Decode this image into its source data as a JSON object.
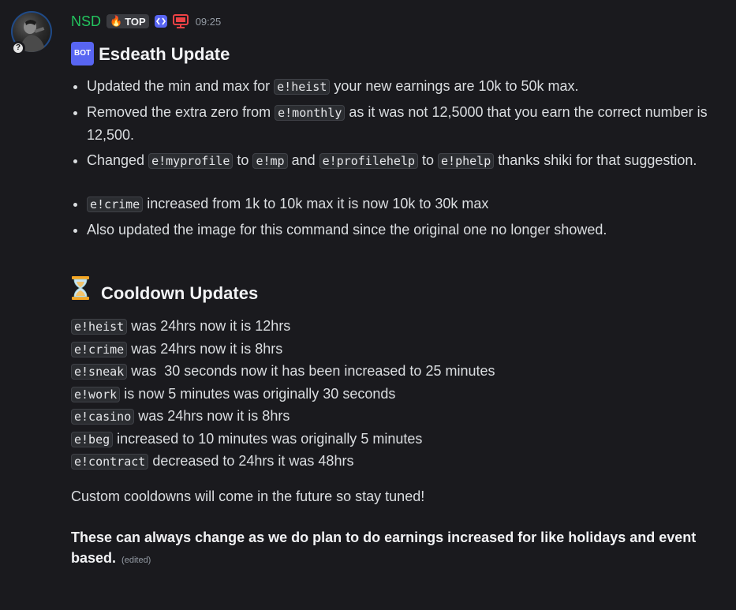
{
  "author": {
    "name": "NSD",
    "tag_label": "TOP",
    "timestamp": "09:25",
    "avatar_badge": "?",
    "name_color": "#23c45e"
  },
  "post": {
    "bot_label": "BOT",
    "title": "Esdeath Update",
    "bullets_1": [
      {
        "parts": [
          "Updated the min and max for ",
          "e!heist",
          " your new earnings are 10k to 50k max."
        ]
      },
      {
        "parts": [
          "Removed the extra zero from ",
          "e!monthly",
          " as it was not 12,5000 that you earn the correct number is 12,500."
        ]
      },
      {
        "parts": [
          "Changed ",
          "e!myprofile",
          " to ",
          "e!mp",
          " and ",
          "e!profilehelp",
          " to ",
          "e!phelp",
          " thanks shiki for that suggestion."
        ]
      }
    ],
    "bullets_2": [
      {
        "parts": [
          "e!crime",
          " increased from 1k to 10k max it is now 10k to 30k max"
        ]
      },
      {
        "parts": [
          "Also updated the image for this command since the original one no longer showed."
        ]
      }
    ],
    "cooldown_title": "Cooldown Updates",
    "cooldown_icon": "hourglass-icon",
    "cooldowns": [
      {
        "cmd": "e!heist",
        "text": " was 24hrs now it is 12hrs"
      },
      {
        "cmd": "e!crime",
        "text": " was 24hrs now it is 8hrs"
      },
      {
        "cmd": "e!sneak",
        "text": " was  30 seconds now it has been increased to 25 minutes"
      },
      {
        "cmd": "e!work",
        "text": " is now 5 minutes was originally 30 seconds"
      },
      {
        "cmd": "e!casino",
        "text": " was 24hrs now it is 8hrs"
      },
      {
        "cmd": "e!beg",
        "text": " increased to 10 minutes was originally 5 minutes"
      },
      {
        "cmd": "e!contract",
        "text": " decreased to 24hrs it was 48hrs"
      }
    ],
    "note": "Custom cooldowns will come in the future so stay tuned!",
    "bold_note": "These can always change as we do plan to do earnings increased for like holidays and event based.",
    "edited_label": "(edited)"
  },
  "colors": {
    "background": "#1a1a1e",
    "text": "#dbdee1",
    "code_bg": "#2b2d31"
  }
}
